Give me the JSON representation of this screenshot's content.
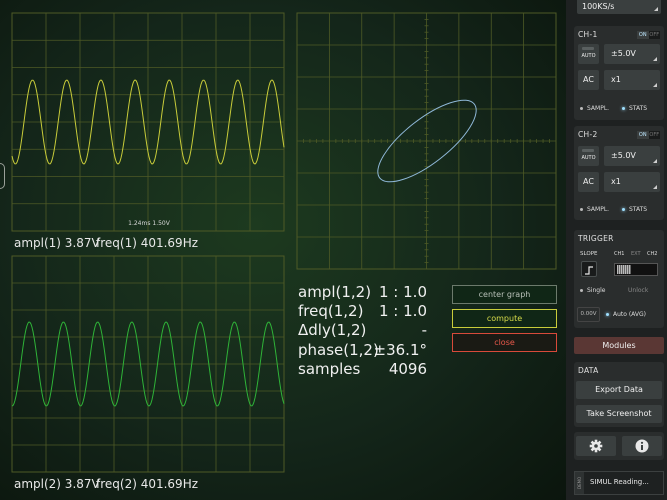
{
  "scope": {
    "timebase_readout": "1.24ms  1.50V",
    "ch1_ampl": "ampl(1) 3.87V",
    "ch1_freq": "freq(1) 401.69Hz",
    "ch2_ampl": "ampl(2) 3.87V",
    "ch2_freq": "freq(2) 401.69Hz",
    "ch1_color": "#c8cc3a",
    "ch2_color": "#2fb338",
    "xy_color": "#8fb8d8",
    "grid_color": "#4e5a26"
  },
  "stats": [
    {
      "label": "ampl(1,2)",
      "value": "1 : 1.0"
    },
    {
      "label": "freq(1,2)",
      "value": "1 : 1.0"
    },
    {
      "label": "Δdly(1,2)",
      "value": "-"
    },
    {
      "label": "phase(1,2)",
      "value": "±36.1°"
    },
    {
      "label": "samples",
      "value": "4096"
    }
  ],
  "controls": {
    "center_graph": "center graph",
    "compute": "compute",
    "close": "close"
  },
  "panel": {
    "sample_rate": "100KS/s",
    "ch1": {
      "title": "CH-1",
      "on": "ON",
      "off": "OFF",
      "auto": "AUTO",
      "range": "±5.0V",
      "coupling": "AC",
      "probe": "x1",
      "sampl": "SAMPL.",
      "stats": "STATS"
    },
    "ch2": {
      "title": "CH-2",
      "on": "ON",
      "off": "OFF",
      "auto": "AUTO",
      "range": "±5.0V",
      "coupling": "AC",
      "probe": "x1",
      "sampl": "SAMPL.",
      "stats": "STATS"
    },
    "trigger": {
      "title": "TRIGGER",
      "slope": "SLOPE",
      "src_ch1": "CH1",
      "src_ext": "EXT",
      "src_ch2": "CH2",
      "single": "Single",
      "unlock": "Unlock",
      "level": "0.00V",
      "mode": "Auto (AVG)"
    },
    "modules": "Modules",
    "data": {
      "title": "DATA",
      "export": "Export Data",
      "screenshot": "Take Screenshot"
    },
    "status": "SIMUL Reading...",
    "status_side": "DEMO"
  }
}
